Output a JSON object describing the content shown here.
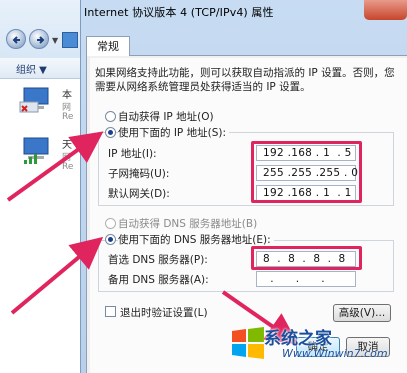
{
  "dialog": {
    "title": "Internet 协议版本 4 (TCP/IPv4) 属性",
    "tab": "常规",
    "description": "如果网络支持此功能，则可以获取自动指派的 IP 设置。否则，您需要从网络系统管理员处获得适当的 IP 设置。",
    "ip_mode": {
      "auto_label": "自动获得 IP 地址(O)",
      "manual_label": "使用下面的 IP 地址(S):",
      "selected": "manual"
    },
    "ip_fields": [
      {
        "label": "IP 地址(I):",
        "value": "192 .168 . 1  . 5"
      },
      {
        "label": "子网掩码(U):",
        "value": "255 .255 .255 . 0"
      },
      {
        "label": "默认网关(D):",
        "value": "192 .168 . 1  . 1"
      }
    ],
    "dns_mode": {
      "auto_label": "自动获得 DNS 服务器地址(B)",
      "manual_label": "使用下面的 DNS 服务器地址(E):",
      "selected": "manual"
    },
    "dns_fields": [
      {
        "label": "首选 DNS 服务器(P):",
        "value": "8  .  8  .  8  .  8"
      },
      {
        "label": "备用 DNS 服务器(A):",
        "value": "  .      .      .   "
      }
    ],
    "validate_label": "退出时验证设置(L)",
    "advanced_label": "高级(V)...",
    "ok_label": "确定",
    "cancel_label": "取消"
  },
  "background": {
    "toolbar_label": "组织 ▼",
    "connections": [
      {
        "label": "本",
        "sub1": "网",
        "sub2": "Re"
      },
      {
        "label": "天",
        "sub1": "网",
        "sub2": "Re"
      }
    ]
  },
  "watermark": {
    "brand": "系统之家",
    "url": "Www.Winwin7.com"
  },
  "colors": {
    "highlight": "#e0245e",
    "accent": "#1c3f8e"
  }
}
